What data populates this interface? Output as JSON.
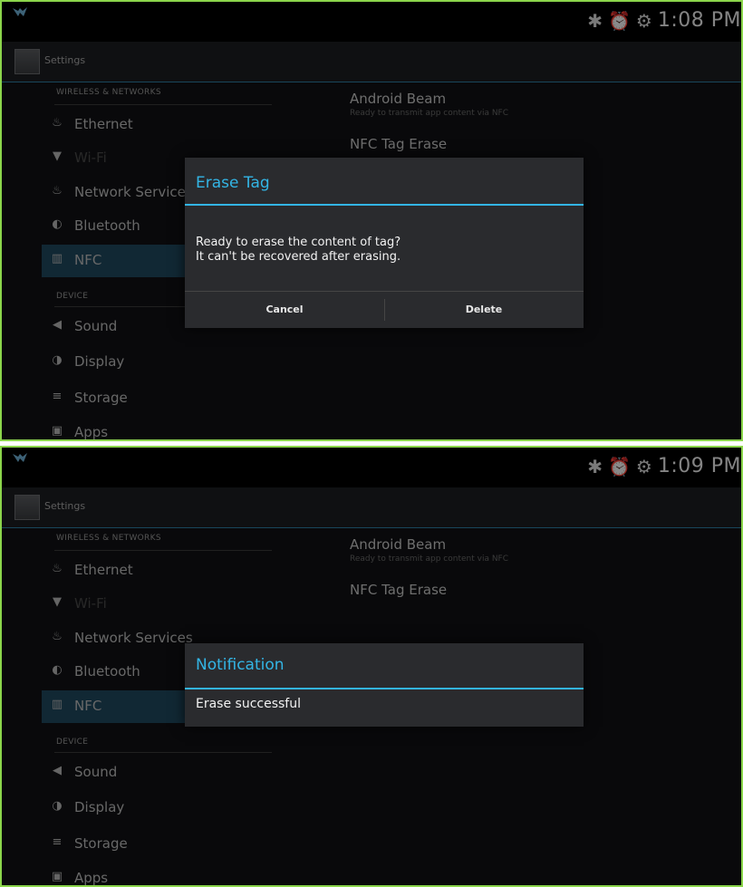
{
  "screens": [
    {
      "status": {
        "time": "1:08 PM"
      },
      "app_bar": {
        "title": "Settings"
      },
      "sections": {
        "wireless": "WIRELESS & NETWORKS",
        "device": "DEVICE"
      },
      "nav": {
        "ethernet": "Ethernet",
        "wifi": "Wi-Fi",
        "network_services": "Network Services",
        "bluetooth": "Bluetooth",
        "nfc": "NFC",
        "sound": "Sound",
        "display": "Display",
        "storage": "Storage",
        "apps": "Apps"
      },
      "prefs": {
        "beam_title": "Android Beam",
        "beam_summary": "Ready to transmit app content via NFC",
        "tag_erase_title": "NFC Tag Erase"
      },
      "dialog": {
        "title": "Erase Tag",
        "message": "Ready to erase the content of tag?\nIt can't be recovered after erasing.",
        "cancel": "Cancel",
        "confirm": "Delete"
      }
    },
    {
      "status": {
        "time": "1:09 PM"
      },
      "app_bar": {
        "title": "Settings"
      },
      "sections": {
        "wireless": "WIRELESS & NETWORKS",
        "device": "DEVICE"
      },
      "nav": {
        "ethernet": "Ethernet",
        "wifi": "Wi-Fi",
        "network_services": "Network Services",
        "bluetooth": "Bluetooth",
        "nfc": "NFC",
        "sound": "Sound",
        "display": "Display",
        "storage": "Storage",
        "apps": "Apps"
      },
      "prefs": {
        "beam_title": "Android Beam",
        "beam_summary": "Ready to transmit app content via NFC",
        "tag_erase_title": "NFC Tag Erase"
      },
      "dialog": {
        "title": "Notification",
        "message": "Erase successful"
      }
    }
  ],
  "icons": {
    "bluetooth": "bluetooth-icon",
    "alarm": "alarm-icon",
    "ethernet": "ethernet-icon",
    "wifi": "wifi-icon",
    "nfc": "nfc-icon",
    "sound": "sound-icon",
    "display": "display-icon",
    "storage": "storage-icon",
    "apps": "apps-icon"
  },
  "colors": {
    "accent": "#33b5e5",
    "selected": "#1f4a60",
    "frame": "#8bd54b"
  }
}
